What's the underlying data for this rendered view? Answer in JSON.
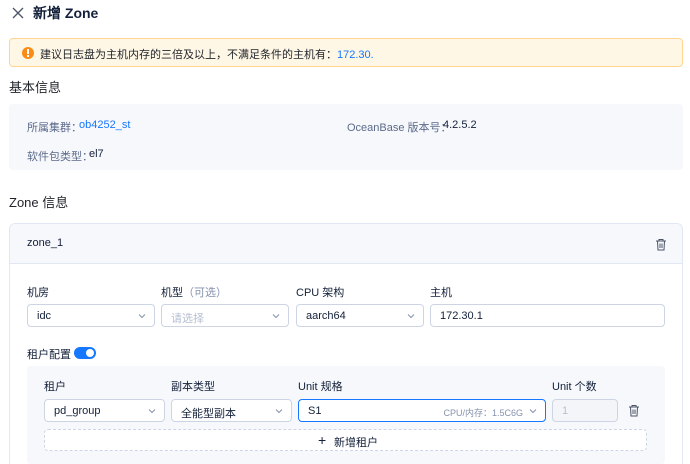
{
  "header": {
    "title": "新增 Zone"
  },
  "alert": {
    "text": "建议日志盘为主机内存的三倍及以上，不满足条件的主机有：",
    "host": "172.30."
  },
  "basic": {
    "title": "基本信息",
    "cluster_label": "所属集群：",
    "cluster_value": "ob4252_st",
    "version_label": "OceanBase 版本号：",
    "version_value": "4.2.5.2",
    "package_label": "软件包类型：",
    "package_value": "el7"
  },
  "zone_section": {
    "title": "Zone 信息"
  },
  "zone": {
    "name": "zone_1",
    "idc": {
      "label": "机房",
      "value": "idc"
    },
    "model": {
      "label": "机型",
      "optional": "（可选）",
      "placeholder": "请选择"
    },
    "cpu": {
      "label": "CPU 架构",
      "value": "aarch64"
    },
    "host": {
      "label": "主机",
      "value": "172.30.1"
    },
    "tenant_config_label": "租户配置"
  },
  "tenant_table": {
    "headers": {
      "tenant": "租户",
      "replica": "副本类型",
      "unit_spec": "Unit 规格",
      "unit_count": "Unit 个数"
    },
    "row": {
      "tenant": "pd_group",
      "replica": "全能型副本",
      "unit_spec": "S1",
      "unit_spec_detail": "CPU/内存：1.5C6G",
      "unit_count": "1"
    },
    "add_label": "新增租户"
  },
  "colors": {
    "primary": "#1677ff",
    "warning": "#fa8c16",
    "warning_bg": "#fff7e6"
  },
  "icons": {
    "close": "close-icon",
    "delete": "trash-icon",
    "chevron": "chevron-down-icon",
    "warning": "exclamation-circle-icon",
    "plus": "plus-icon"
  }
}
